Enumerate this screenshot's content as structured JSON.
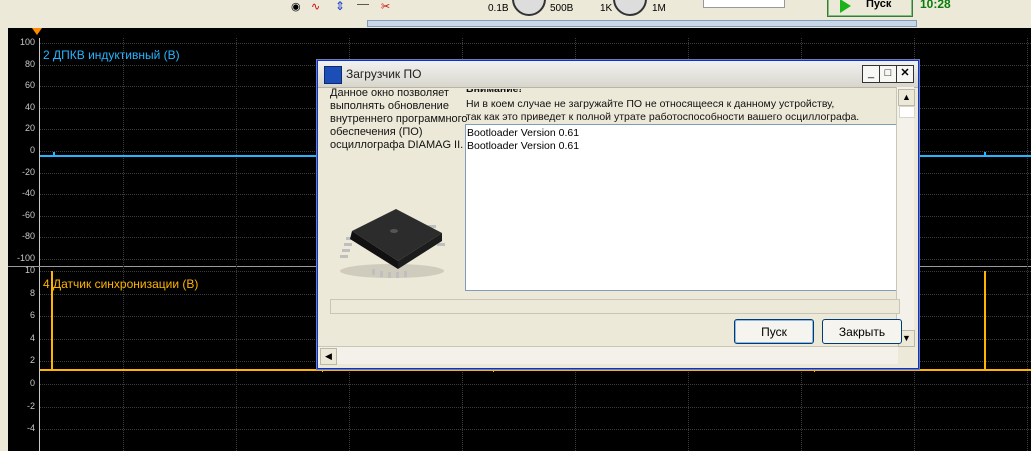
{
  "toolbar": {
    "volt_min": "0.1В",
    "volt_max": "500В",
    "res_min": "1K",
    "res_max": "1M",
    "start_label": "Пуск",
    "time": "10:28"
  },
  "channels": [
    {
      "name": "2 ДПКВ индуктивный (В)",
      "color": "#26b5ff",
      "ticks": [
        "100",
        "80",
        "60",
        "40",
        "20",
        "0",
        "-20",
        "-40",
        "-60",
        "-80",
        "-100"
      ]
    },
    {
      "name": "4 Датчик синхронизации (В)",
      "color": "#ffb400",
      "ticks": [
        "10",
        "8",
        "6",
        "4",
        "2",
        "0",
        "-2",
        "-4"
      ]
    }
  ],
  "dialog": {
    "title": "Загрузчик ПО",
    "description": "Данное окно позволяет выполнять обновление внутреннего программного обеспечения (ПО) осциллографа DIAMAG II.",
    "warning_heading": "Внимание!",
    "warning_line1": "Ни в коем случае не загружайте ПО не относящееся к данному устройству,",
    "warning_line2": "так как это приведет к полной утрате работоспособности вашего осциллографа.",
    "log_lines": [
      "Bootloader Version 0.61",
      "Bootloader Version 0.61"
    ],
    "start_button": "Пуск",
    "close_button": "Закрыть"
  }
}
